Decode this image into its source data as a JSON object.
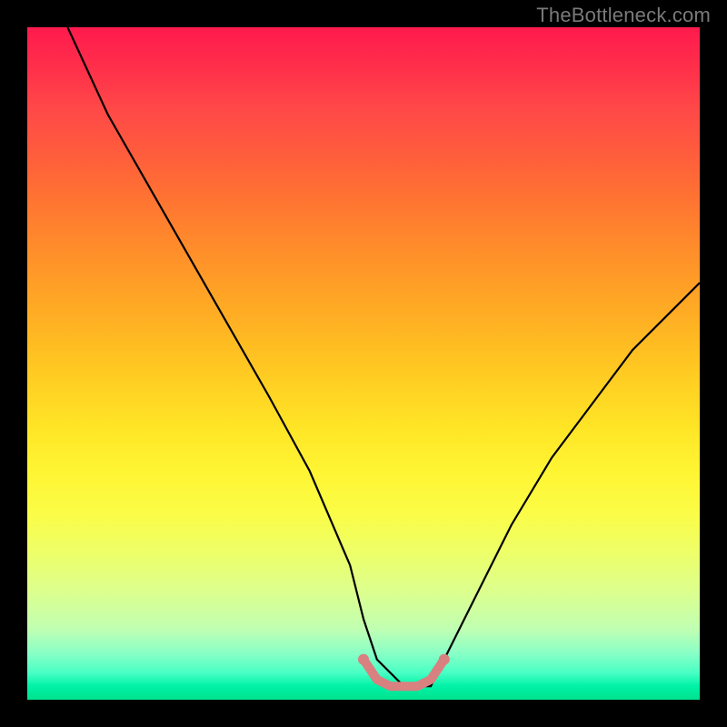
{
  "watermark": "TheBottleneck.com",
  "chart_data": {
    "type": "line",
    "title": "",
    "xlabel": "",
    "ylabel": "",
    "xlim": [
      0,
      100
    ],
    "ylim": [
      0,
      100
    ],
    "grid": false,
    "legend": false,
    "series": [
      {
        "name": "bottleneck-curve",
        "color": "#000000",
        "x": [
          6,
          12,
          20,
          28,
          36,
          42,
          48,
          50,
          52,
          56,
          60,
          62,
          66,
          72,
          78,
          84,
          90,
          96,
          100
        ],
        "y": [
          100,
          87,
          73,
          59,
          45,
          34,
          20,
          12,
          6,
          2,
          2,
          6,
          14,
          26,
          36,
          44,
          52,
          58,
          62
        ]
      },
      {
        "name": "bottom-highlight",
        "color": "#d98080",
        "x": [
          50,
          52,
          54,
          56,
          58,
          60,
          62
        ],
        "y": [
          6,
          3,
          2,
          2,
          2,
          3,
          6
        ]
      }
    ],
    "background_gradient": {
      "stops": [
        {
          "pct": 0,
          "color": "#ff1a4d"
        },
        {
          "pct": 50,
          "color": "#ffd323"
        },
        {
          "pct": 75,
          "color": "#fbfc45"
        },
        {
          "pct": 100,
          "color": "#00e28e"
        }
      ]
    }
  }
}
